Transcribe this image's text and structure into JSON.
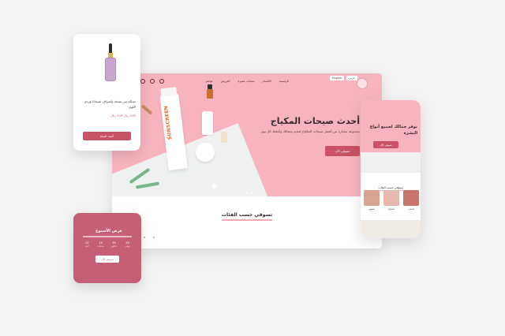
{
  "desktop": {
    "nav_links": [
      "الرئيسية",
      "الأقسام",
      "منتجات مميزة",
      "العروض",
      "تواصل"
    ],
    "lang": [
      "English",
      "عربي"
    ],
    "hero_title": "أحدث صيحات المكياج",
    "hero_subtitle": "مجموعة مختارة من أفضل منتجات المكياج لعناية بجمالك وأناقتك كل يوم",
    "hero_button": "تسوقي الآن",
    "product_word": "SUNSCREEN",
    "shop_title": "تسوقي حسب الفئات"
  },
  "product_card": {
    "name": "تسكة من نسخة بإشراف شيجانا وردي اللون",
    "price": "199 ريال  249 ريال",
    "button": "أضف للسلة"
  },
  "offer_card": {
    "title": "عرض الأسبوع",
    "timer": [
      {
        "num": "02",
        "label": "أيام"
      },
      {
        "num": "14",
        "label": "ساعات"
      },
      {
        "num": "35",
        "label": "دقائق"
      },
      {
        "num": "20",
        "label": "ثواني"
      }
    ],
    "button": "تسوقي الآن"
  },
  "mobile": {
    "hero_title": "نوفر جمالك لجميع أنواع البشرة",
    "hero_button": "تسوقي الآن",
    "shop_title": "تسوقي حسب الفئات",
    "categories": [
      {
        "name": "العطور",
        "color": "#d9a48f"
      },
      {
        "name": "المكياج",
        "color": "#e6b8b0"
      },
      {
        "name": "العناية",
        "color": "#c9746b"
      }
    ]
  },
  "colors": {
    "accent": "#c95266",
    "hero_pink": "#f7b4bf",
    "offer_pink": "#c55f75"
  }
}
